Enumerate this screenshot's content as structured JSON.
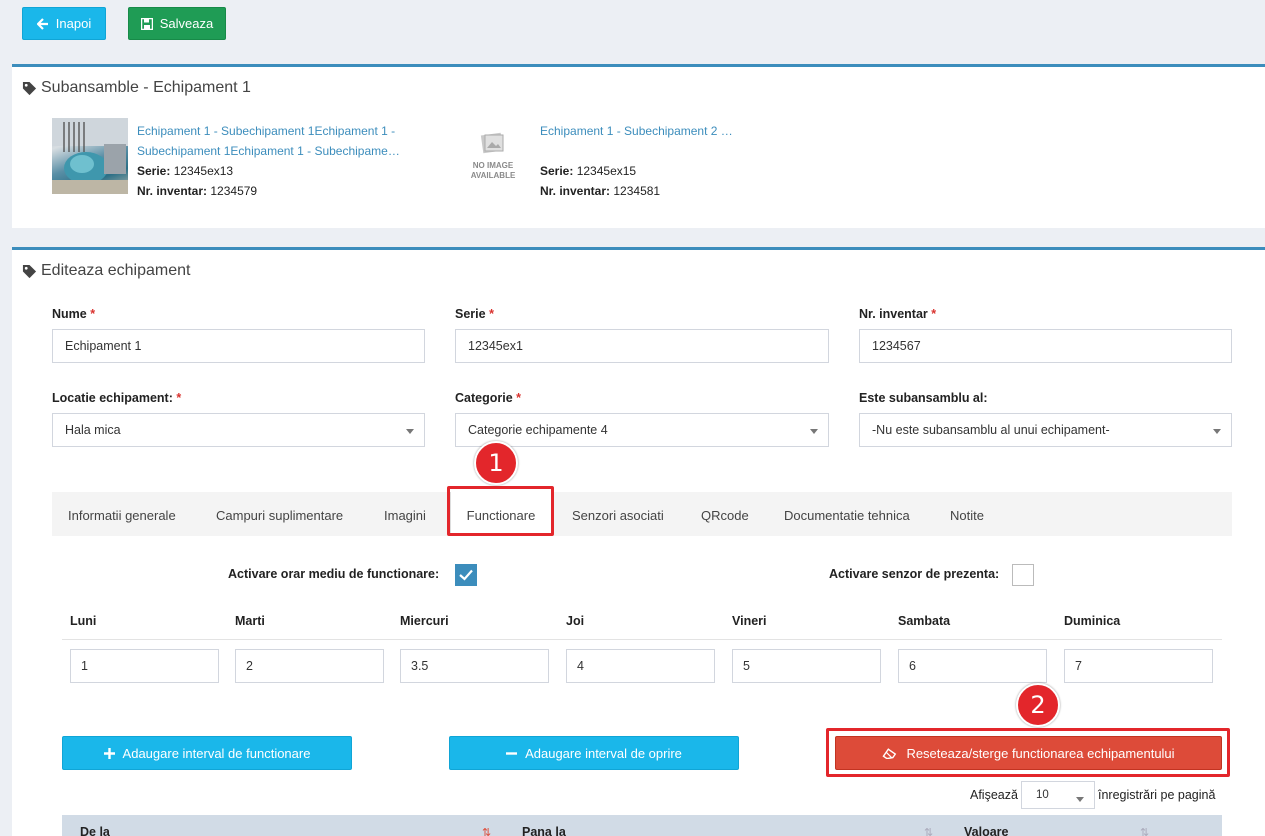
{
  "toolbar": {
    "back_label": "Inapoi",
    "save_label": "Salveaza"
  },
  "subassemblies": {
    "title": "Subansamble - Echipament 1",
    "items": [
      {
        "name_line1": "Echipament 1 - Subechipament 1Echipament 1 -",
        "name_line2": "Subechipament 1Echipament 1 - Subechipame…",
        "serie_label": "Serie:",
        "serie": "12345ex13",
        "inv_label": "Nr. inventar:",
        "inventar": "1234579"
      },
      {
        "name_line1": "Echipament 1 - Subechipament 2 …",
        "name_line2": "",
        "serie_label": "Serie:",
        "serie": "12345ex15",
        "inv_label": "Nr. inventar:",
        "inventar": "1234581",
        "no_image_l1": "NO IMAGE",
        "no_image_l2": "AVAILABLE"
      }
    ]
  },
  "edit": {
    "title": "Editeaza echipament",
    "fields": {
      "nume": {
        "label": "Nume",
        "value": "Echipament 1"
      },
      "serie": {
        "label": "Serie",
        "value": "12345ex1"
      },
      "inventar": {
        "label": "Nr. inventar",
        "value": "1234567"
      },
      "locatie": {
        "label": "Locatie echipament:",
        "value": "Hala mica"
      },
      "categorie": {
        "label": "Categorie",
        "value": "Categorie echipamente 4"
      },
      "subansamblu": {
        "label": "Este subansamblu al:",
        "value": "-Nu este subansamblu al unui echipament-"
      }
    },
    "required_mark": "*"
  },
  "tabs": [
    "Informatii generale",
    "Campuri suplimentare",
    "Imagini",
    "Functionare",
    "Senzori asociati",
    "QRcode",
    "Documentatie tehnica",
    "Notite"
  ],
  "active_tab": "Functionare",
  "functionare": {
    "orar_label": "Activare orar mediu de functionare:",
    "orar_checked": true,
    "senzor_label": "Activare senzor de prezenta:",
    "senzor_checked": false,
    "days": [
      {
        "name": "Luni",
        "value": "1"
      },
      {
        "name": "Marti",
        "value": "2"
      },
      {
        "name": "Miercuri",
        "value": "3.5"
      },
      {
        "name": "Joi",
        "value": "4"
      },
      {
        "name": "Vineri",
        "value": "5"
      },
      {
        "name": "Sambata",
        "value": "6"
      },
      {
        "name": "Duminica",
        "value": "7"
      }
    ],
    "btn_add_interval": "Adaugare interval de functionare",
    "btn_add_stop": "Adaugare interval de oprire",
    "btn_reset": "Reseteaza/sterge functionarea echipamentului",
    "show_label": "Afişează",
    "per_page": "10",
    "per_page_suffix": "înregistrări pe pagină",
    "columns": [
      "De la",
      "Pana la",
      "Valoare"
    ]
  },
  "annotations": {
    "badge1": "1",
    "badge2": "2"
  },
  "colors": {
    "primary": "#3c8dbc",
    "cyan": "#1ab7ea",
    "green": "#1f9c55",
    "danger": "#dd4b39",
    "highlight": "#e3262b"
  }
}
